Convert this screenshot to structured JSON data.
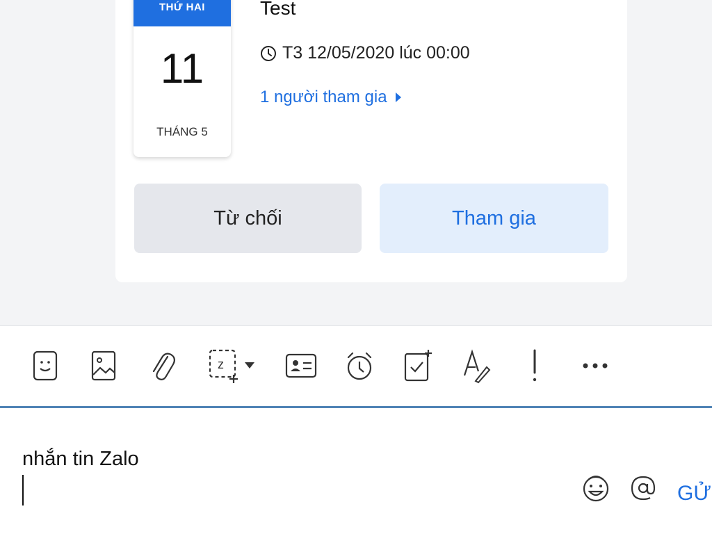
{
  "event": {
    "weekday": "THỨ HAI",
    "day": "11",
    "month": "THÁNG 5",
    "title": "Test",
    "time": "T3 12/05/2020 lúc 00:00",
    "participants": "1 người tham gia",
    "decline_label": "Từ chối",
    "join_label": "Tham gia"
  },
  "toolbar": {
    "icons": [
      "sticker-icon",
      "image-icon",
      "attachment-icon",
      "screenshot-icon",
      "contact-card-icon",
      "reminder-icon",
      "task-icon",
      "text-format-icon",
      "important-icon",
      "more-icon"
    ]
  },
  "composer": {
    "value": "nhắn tin Zalo",
    "send_label": "GỬI"
  },
  "colors": {
    "accent": "#1f6fe0",
    "divider": "#4f83b5",
    "decline_bg": "#e5e7ec",
    "join_bg": "#e3eefc"
  }
}
